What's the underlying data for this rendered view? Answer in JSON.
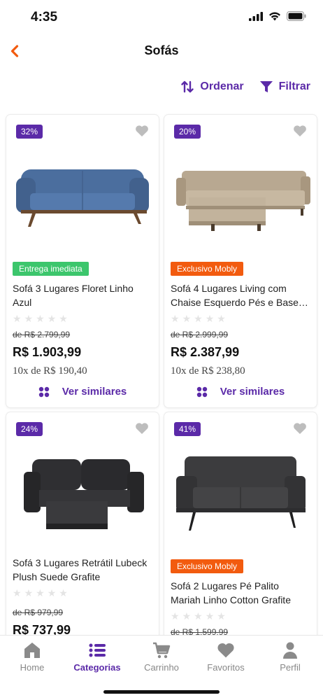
{
  "status": {
    "time": "4:35"
  },
  "header": {
    "title": "Sofás",
    "back_icon": "chevron-left-icon"
  },
  "toolbar": {
    "sort_label": "Ordenar",
    "filter_label": "Filtrar"
  },
  "products": [
    {
      "discount": "32%",
      "tag": "Entrega imediata",
      "name": "Sofá 3 Lugares Floret Linho Azul",
      "old_price": "de R$ 2.799,99",
      "price": "R$ 1.903,99",
      "installments": "10x de R$ 190,40",
      "similar": "Ver similares",
      "rating_stars": 0
    },
    {
      "discount": "20%",
      "tag": "Exclusivo Mobly",
      "name": "Sofá 4 Lugares Living com Chaise Esquerdo Pés e Base…",
      "old_price": "de R$ 2.999,99",
      "price": "R$ 2.387,99",
      "installments": "10x de R$ 238,80",
      "similar": "Ver similares",
      "rating_stars": 0
    },
    {
      "discount": "24%",
      "tag": "",
      "name": "Sofá 3 Lugares Retrátil Lubeck Plush Suede Grafite",
      "old_price": "de R$ 979,99",
      "price": "R$ 737,99",
      "rating_stars": 0
    },
    {
      "discount": "41%",
      "tag": "Exclusivo Mobly",
      "name": "Sofá 2 Lugares Pé Palito Mariah Linho Cotton Grafite",
      "old_price": "de R$ 1.599,99",
      "rating_stars": 0
    }
  ],
  "tabbar": {
    "items": [
      {
        "label": "Home",
        "icon": "home-icon"
      },
      {
        "label": "Categorias",
        "icon": "list-icon",
        "active": true
      },
      {
        "label": "Carrinho",
        "icon": "cart-icon"
      },
      {
        "label": "Favoritos",
        "icon": "heart-icon"
      },
      {
        "label": "Perfil",
        "icon": "user-icon"
      }
    ]
  },
  "colors": {
    "accent": "#5b2aa8",
    "tag_green": "#3cc66c",
    "tag_orange": "#f25b0f",
    "back": "#f25b0f"
  }
}
